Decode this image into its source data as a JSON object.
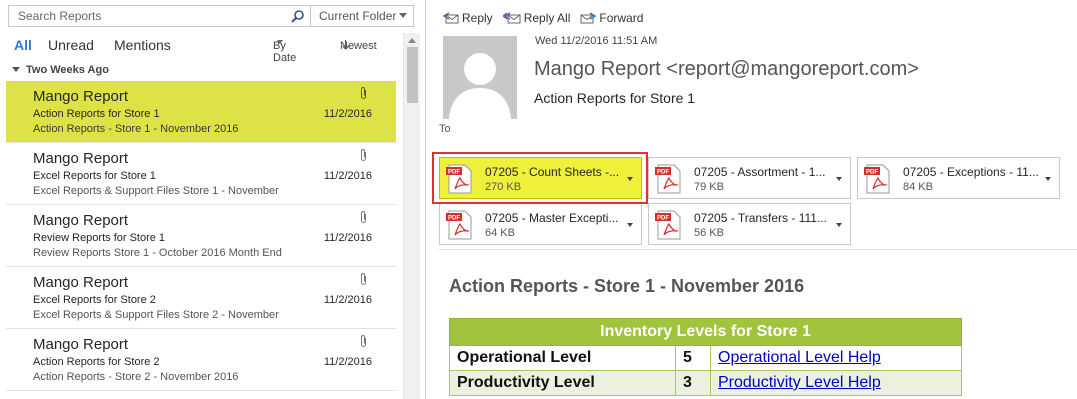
{
  "search": {
    "placeholder": "Search Reports",
    "scope": "Current Folder"
  },
  "filters": {
    "all": "All",
    "unread": "Unread",
    "mentions": "Mentions",
    "sort_by": "By Date",
    "order": "Newest"
  },
  "group": {
    "label": "Two Weeks Ago"
  },
  "messages": [
    {
      "from": "Mango Report",
      "subject": "Action Reports for Store 1",
      "preview": "Action Reports - Store 1 - November 2016",
      "date": "11/2/2016"
    },
    {
      "from": "Mango Report",
      "subject": "Excel Reports for Store 1",
      "preview": "Excel Reports & Support Files Store 1 - November",
      "date": "11/2/2016"
    },
    {
      "from": "Mango Report",
      "subject": "Review Reports for Store 1",
      "preview": "Review Reports Store 1 - October 2016 Month End",
      "date": "11/2/2016"
    },
    {
      "from": "Mango Report",
      "subject": "Excel Reports for Store 2",
      "preview": "Excel Reports & Support Files Store 2 - November",
      "date": "11/2/2016"
    },
    {
      "from": "Mango Report",
      "subject": "Action Reports for Store 2",
      "preview": "Action Reports - Store 2 - November 2016",
      "date": "11/2/2016"
    }
  ],
  "actions": {
    "reply": "Reply",
    "reply_all": "Reply All",
    "forward": "Forward"
  },
  "reading": {
    "datetime": "Wed 11/2/2016 11:51 AM",
    "sender": "Mango Report <report@mangoreport.com>",
    "subject": "Action Reports for Store 1",
    "to_label": "To"
  },
  "attachments": [
    {
      "name": "07205 - Count Sheets -...",
      "size": "270 KB"
    },
    {
      "name": "07205 - Assortment - 1...",
      "size": "79 KB"
    },
    {
      "name": "07205 - Exceptions - 11...",
      "size": "84 KB"
    },
    {
      "name": "07205 - Master Excepti...",
      "size": "64 KB"
    },
    {
      "name": "07205 - Transfers - 111...",
      "size": "56 KB"
    }
  ],
  "body": {
    "title": "Action Reports - Store 1 - November 2016",
    "table_header": "Inventory Levels for Store 1",
    "rows": [
      {
        "label": "Operational Level",
        "value": "5",
        "link": "Operational Level Help"
      },
      {
        "label": "Productivity Level",
        "value": "3",
        "link": "Productivity Level Help"
      }
    ]
  },
  "colors": {
    "selected": "#dde346",
    "accent": "#2b7cd3",
    "table_green": "#a1c43e",
    "highlight_box": "#e03030"
  }
}
